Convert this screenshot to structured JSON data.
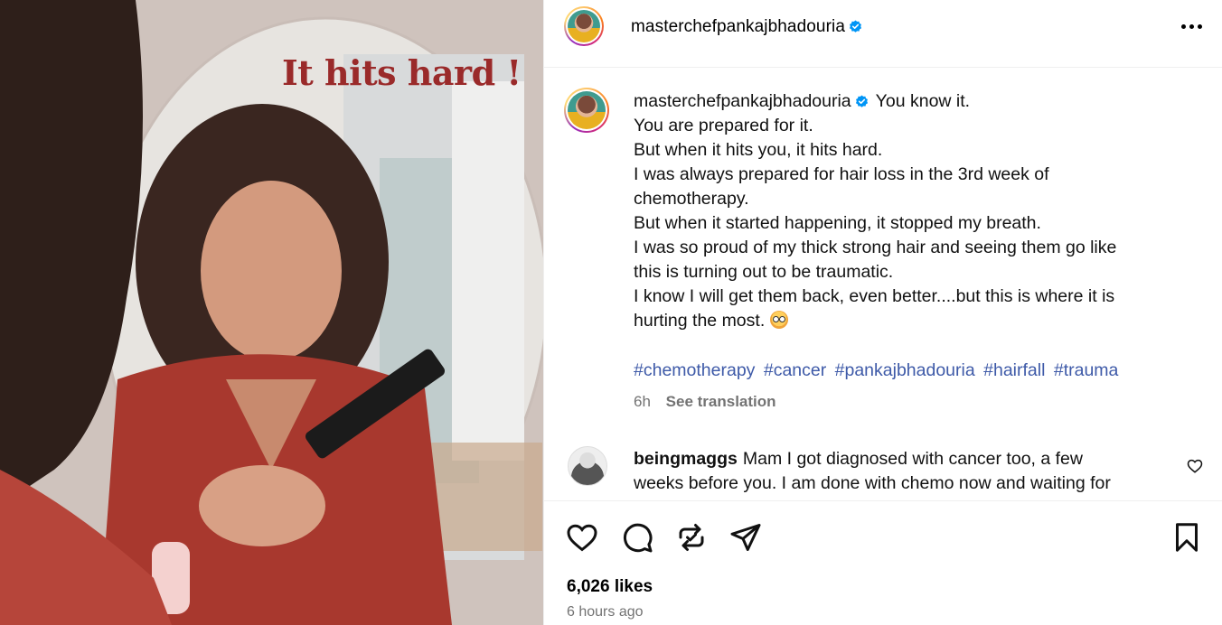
{
  "image": {
    "overlay_text": "It hits hard !"
  },
  "post": {
    "author": "masterchefpankajbhadouria",
    "more_options_icon": "more-horizontal-icon",
    "caption_lines": [
      "You know it.",
      "You are prepared for it.",
      "But when it hits you, it hits hard.",
      "I was always prepared for hair loss in the 3rd week of",
      "chemotherapy.",
      "But when it started happening, it stopped my breath.",
      "I was so proud of my thick strong hair and seeing them go like",
      "this is turning out to be traumatic.",
      "I know I will get them back, even better....but this is where it is",
      "hurting the most."
    ],
    "hashtags": [
      "#chemotherapy",
      "#cancer",
      "#pankajbhadouria",
      "#hairfall",
      "#trauma"
    ],
    "age": "6h",
    "see_translation": "See translation",
    "likes": "6,026 likes",
    "timestamp": "6 hours ago"
  },
  "comment": {
    "author": "beingmaggs",
    "text_line1": "Mam I got diagnosed with cancer too, a few",
    "text_line2": "weeks before you. I am done with chemo now and waiting for"
  },
  "colors": {
    "link": "#3e5aa8",
    "verified": "#0095f6",
    "secondary_text": "#737373",
    "overlay_text": "#9a2a2a"
  }
}
